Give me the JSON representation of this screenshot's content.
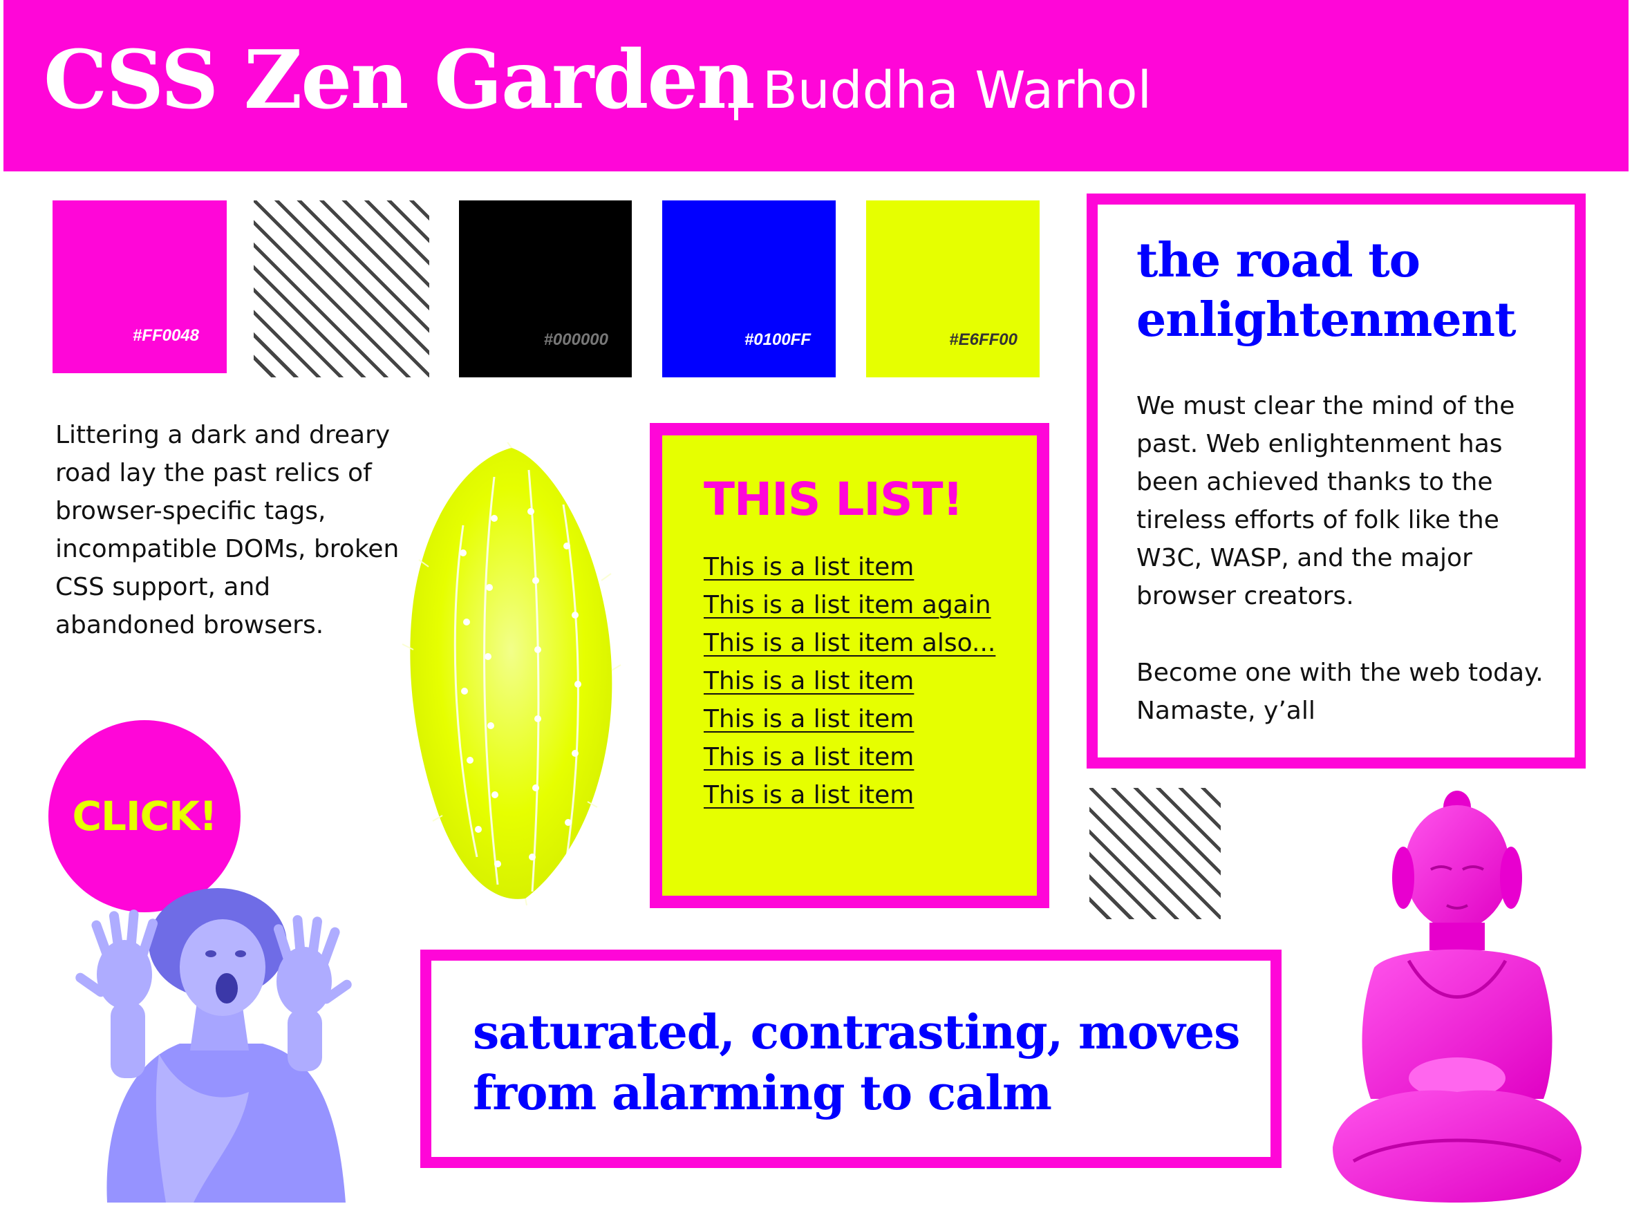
{
  "header": {
    "title": "CSS Zen Garden",
    "subtitle": "Buddha Warhol"
  },
  "swatches": [
    {
      "hex": "#FF0048",
      "color": "#ff06d8",
      "text_color": "#ffffff"
    },
    {
      "hex": "",
      "pattern": "diagonal-stripes"
    },
    {
      "hex": "#000000",
      "color": "#000000",
      "text_color": "#777777"
    },
    {
      "hex": "#0100FF",
      "color": "#0100ff",
      "text_color": "#ffffff"
    },
    {
      "hex": "#E6FF00",
      "color": "#e6ff00",
      "text_color": "#333333"
    }
  ],
  "intro": {
    "text": "Littering a dark and dreary road lay the past relics of browser-specific tags, incompatible DOMs, broken CSS support, and abandoned browsers."
  },
  "click_button": {
    "label": "CLICK!"
  },
  "list": {
    "title": "THIS LIST!",
    "items": [
      "This is a list item",
      "This is a list item again",
      "This is a list item also...",
      "This is a list item",
      "This is a list item",
      "This is a list item",
      "This is a list item"
    ]
  },
  "enlightenment": {
    "title": "the road to enlightenment",
    "paragraph1": "We must clear the mind of the past. Web enlightenment has been achieved thanks to the tireless efforts of folk like the W3C, WASP, and the major browser creators.",
    "paragraph2": "Become one with the web today. Namaste, y’all"
  },
  "quote": {
    "text": "saturated, contrasting, moves from alarming to calm"
  },
  "colors": {
    "magenta": "#ff06d8",
    "blue": "#0100ff",
    "lime": "#e6ff00",
    "lavender": "#8f8cff"
  },
  "images": {
    "cactus": "cactus-icon",
    "woman": "screaming-woman-icon",
    "buddha": "buddha-statue-icon"
  }
}
